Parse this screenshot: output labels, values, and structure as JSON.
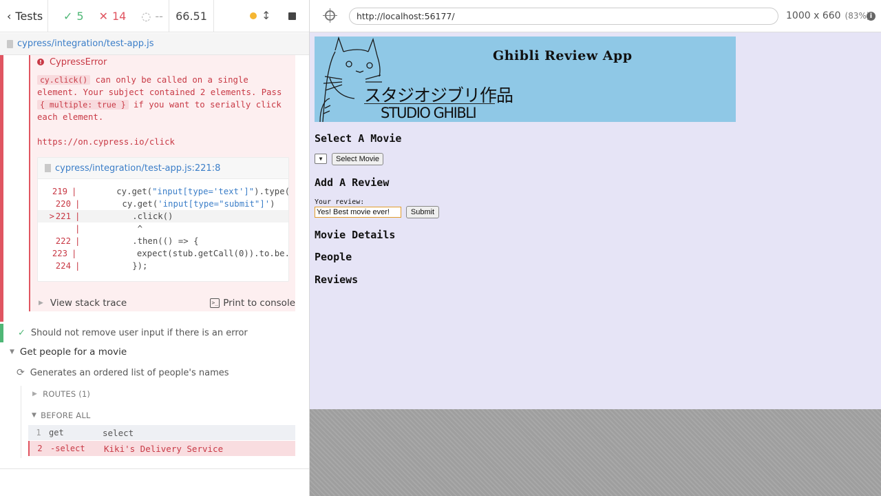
{
  "reporter": {
    "tests_label": "Tests",
    "passed": "5",
    "failed": "14",
    "pending": "--",
    "duration": "66.51",
    "spec_path": "cypress/integration/test-app.js"
  },
  "error": {
    "title": "CypressError",
    "message_code1": "cy.click()",
    "message_part1": " can only be called on a single element. Your subject contained 2 elements. Pass ",
    "message_code2": "{ multiple: true }",
    "message_part2": " if you want to serially click each element.",
    "link": "https://on.cypress.io/click",
    "code_file": "cypress/integration/test-app.js:221:8",
    "code_lines": [
      {
        "mark": "",
        "num": "219",
        "pipe": "|",
        "pre": "      cy.get(",
        "str": "\"input[type='text']\"",
        "post": ").type("
      },
      {
        "mark": "",
        "num": "220",
        "pipe": "|",
        "pre": "      cy.get(",
        "str": "'input[type=\"submit\"]'",
        "post": ")"
      },
      {
        "mark": ">",
        "num": "221",
        "pipe": "|",
        "pre": "        .click()",
        "str": "",
        "post": ""
      },
      {
        "mark": "",
        "num": "",
        "pipe": "|",
        "pre": "         ^",
        "str": "",
        "post": ""
      },
      {
        "mark": "",
        "num": "222",
        "pipe": "|",
        "pre": "        .then(() => {",
        "str": "",
        "post": ""
      },
      {
        "mark": "",
        "num": "223",
        "pipe": "|",
        "pre": "          expect(stub.getCall(0)).to.be.",
        "str": "",
        "post": ""
      },
      {
        "mark": "",
        "num": "224",
        "pipe": "|",
        "pre": "        });",
        "str": "",
        "post": ""
      }
    ],
    "stack_trace_label": "View stack trace",
    "print_label": "Print to console"
  },
  "tests": {
    "passed_test": "Should not remove user input if there is an error",
    "suite": "Get people for a movie",
    "running_test": "Generates an ordered list of people's names",
    "routes": "ROUTES (1)",
    "before_all": "BEFORE ALL",
    "commands": [
      {
        "num": "1",
        "name": "get",
        "message": "select"
      },
      {
        "num": "2",
        "name": "-select",
        "message": "Kiki's Delivery Service"
      }
    ]
  },
  "browser": {
    "url": "http://localhost:56177/",
    "viewport": "1000 x 660",
    "scale": "(83%)"
  },
  "app": {
    "title": "Ghibli Review App",
    "logo_jp": "スタジオジブリ作品",
    "logo_en": "STUDIO GHIBLI",
    "select_heading": "Select A Movie",
    "select_button": "Select Movie",
    "add_heading": "Add A Review",
    "review_label": "Your review:",
    "review_value": "Yes! Best movie ever!",
    "submit_button": "Submit",
    "details_heading": "Movie Details",
    "people_heading": "People",
    "reviews_heading": "Reviews"
  },
  "colors": {
    "pass": "#4fb776",
    "fail": "#e05561",
    "app_background": "#e6e4f6",
    "banner": "#8fc8e6"
  }
}
